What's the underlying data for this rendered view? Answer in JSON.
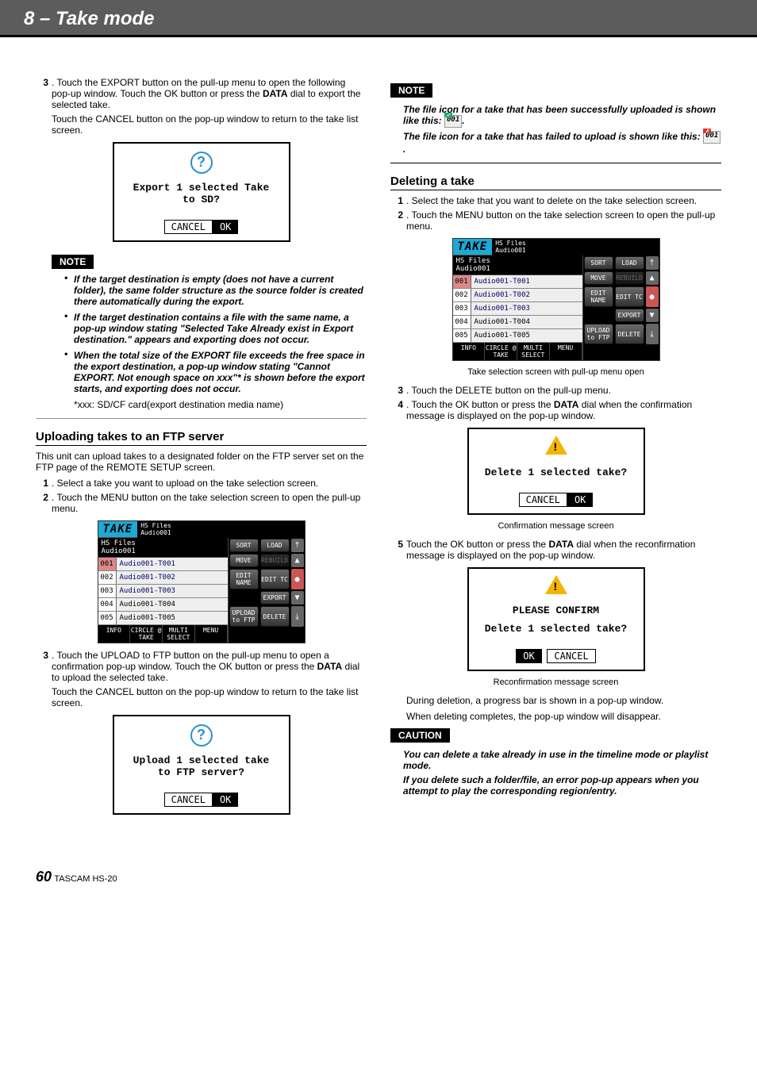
{
  "header": {
    "title": "8 – Take mode"
  },
  "left": {
    "step3a": ". Touch the EXPORT button on the pull-up menu to open the following pop-up window. Touch the OK button or press the ",
    "step3b": " dial to export the selected take.",
    "step3c": "Touch the CANCEL button on the pop-up window to return to the take list screen.",
    "dialog1": {
      "line1": "Export 1 selected Take",
      "line2": "to SD?",
      "cancel": "CANCEL",
      "ok": "OK"
    },
    "note1": "If the target destination is empty (does not have a current folder), the same folder structure as the source folder is created there automatically during the export.",
    "note2": "If the target destination contains a file with the same name, a pop-up window stating \"Selected Take Already exist in Export destination.\" appears and exporting does not occur.",
    "note3": "When the total size of the EXPORT file exceeds the free space in the export destination, a pop-up window stating \"Cannot EXPORT. Not enough space on xxx\"* is shown before the export starts, and exporting does not occur.",
    "note_plain": "*xxx: SD/CF card(export destination media name)",
    "h_upload": " Uploading takes to an FTP server",
    "upload_intro": "This unit can upload takes to a designated folder on the FTP server set on the FTP page of the REMOTE SETUP screen.",
    "u_step1": ". Select a take you want to upload on the take selection screen.",
    "u_step2": ". Touch the MENU button on the take selection screen to open the pull-up menu.",
    "u_step3a": ". Touch the UPLOAD to FTP button on the pull-up menu to open a confirmation pop-up window. Touch the OK button or press the ",
    "u_step3b": " dial to upload the selected take.",
    "u_step3c": "Touch the CANCEL button on the pop-up window to return to the take list screen.",
    "dialog2": {
      "line1": "Upload 1 selected take",
      "line2": "to FTP server?",
      "cancel": "CANCEL",
      "ok": "OK"
    }
  },
  "take_screen": {
    "title": "TAKE",
    "path1": "HS Files",
    "path2": "Audio001",
    "crumb": "HS Files\nAudio001",
    "rows": [
      {
        "num": "001",
        "name": "Audio001-T001"
      },
      {
        "num": "002",
        "name": "Audio001-T002"
      },
      {
        "num": "003",
        "name": "Audio001-T003"
      },
      {
        "num": "004",
        "name": "Audio001-T004"
      },
      {
        "num": "005",
        "name": "Audio001-T005"
      }
    ],
    "bottom": [
      "INFO",
      "CIRCLE @\nTAKE",
      "MULTI\nSELECT",
      "MENU"
    ],
    "side": {
      "r1a": "SORT",
      "r1b": "LOAD",
      "r2a": "MOVE",
      "r2b": "REBUILD",
      "r3a": "EDIT\nNAME",
      "r3b": "EDIT TC",
      "r4": "EXPORT",
      "r5a": "UPLOAD\nto FTP",
      "r5b": "DELETE"
    }
  },
  "right": {
    "note_icon1": "The file icon for a take that has been successfully uploaded is shown like this: ",
    "note_icon2": "The file icon for a take that has failed to upload is shown like this: ",
    "icon_ok_text": "001",
    "icon_fail_text": "001",
    "period": ".",
    "h_delete": "Deleting a take",
    "d_step1": ". Select the take that you want to delete on the take selection screen.",
    "d_step2": ". Touch the MENU button on the take selection screen to open the pull-up menu.",
    "caption1": "Take selection screen with pull-up menu open",
    "d_step3": ". Touch the DELETE button on the pull-up menu.",
    "d_step4a": ". Touch the OK button or press the ",
    "d_step4b": " dial when the confirmation message is displayed on the pop-up window.",
    "dialog3": {
      "line1": "Delete 1 selected take?",
      "cancel": "CANCEL",
      "ok": "OK"
    },
    "caption2": "Confirmation message screen",
    "d_step5a": "Touch the OK button or press the ",
    "d_step5b": " dial when the reconfirmation message is displayed on the pop-up window.",
    "dialog4": {
      "top": "PLEASE CONFIRM",
      "line1": "Delete 1 selected take?",
      "ok": "OK",
      "cancel": "CANCEL"
    },
    "caption3": "Reconfirmation message screen",
    "d_para1": "During deletion, a progress bar is shown in a pop-up window.",
    "d_para2": "When deleting completes, the pop-up window will disappear.",
    "caution1": "You can delete a take already in use in the timeline mode or playlist mode.",
    "caution2": "If you delete such a folder/file, an error pop-up appears when you attempt to play the corresponding region/entry."
  },
  "labels": {
    "note": "NOTE",
    "caution": "CAUTION",
    "data": "DATA"
  },
  "footer": {
    "page": "60",
    "model": "TASCAM HS-20"
  }
}
